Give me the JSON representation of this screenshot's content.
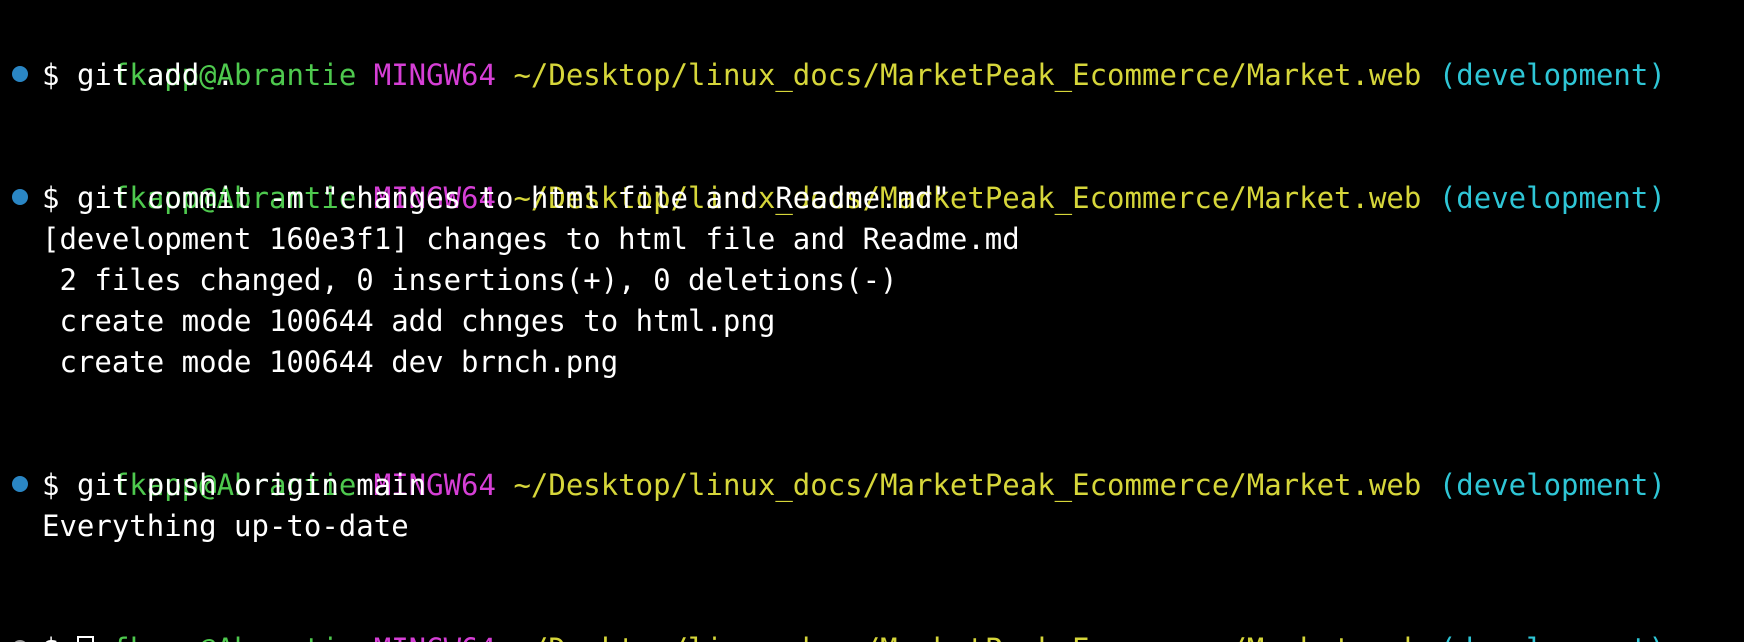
{
  "prompt": {
    "user_host": "fkapp@Abrantie",
    "system": "MINGW64",
    "path": "~/Desktop/linux_docs/MarketPeak_Ecommerce/Market.web",
    "branch": "(development)",
    "symbol": "$"
  },
  "colors": {
    "background": "#000000",
    "user_host": "#4ec94e",
    "system": "#d63fd6",
    "path": "#d6d63a",
    "branch": "#2fc6d6",
    "text": "#ffffff",
    "status_dot": "#2a86c4"
  },
  "blocks": [
    {
      "command": "git add .",
      "output": []
    },
    {
      "command": "git commit -m \"changes to html file and Readme.md\"",
      "output": [
        "[development 160e3f1] changes to html file and Readme.md",
        " 2 files changed, 0 insertions(+), 0 deletions(-)",
        " create mode 100644 add chnges to html.png",
        " create mode 100644 dev brnch.png"
      ]
    },
    {
      "command": "git push origin main",
      "output": [
        "Everything up-to-date"
      ]
    }
  ],
  "current_command": ""
}
